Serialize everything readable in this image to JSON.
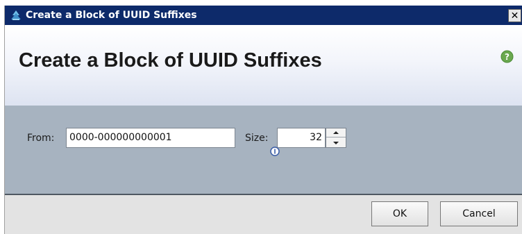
{
  "window": {
    "title": "Create a Block of UUID Suffixes",
    "close_label": "✕"
  },
  "header": {
    "title": "Create a Block of UUID Suffixes",
    "help_icon": "help-icon"
  },
  "form": {
    "from_label": "From:",
    "from_value": "0000-000000000001",
    "size_label": "Size:",
    "size_value": "32"
  },
  "footer": {
    "ok_label": "OK",
    "cancel_label": "Cancel"
  },
  "colors": {
    "titlebar": "#0d2a6a",
    "form_panel": "#a7b3c0",
    "help_green": "#6aa84f"
  }
}
